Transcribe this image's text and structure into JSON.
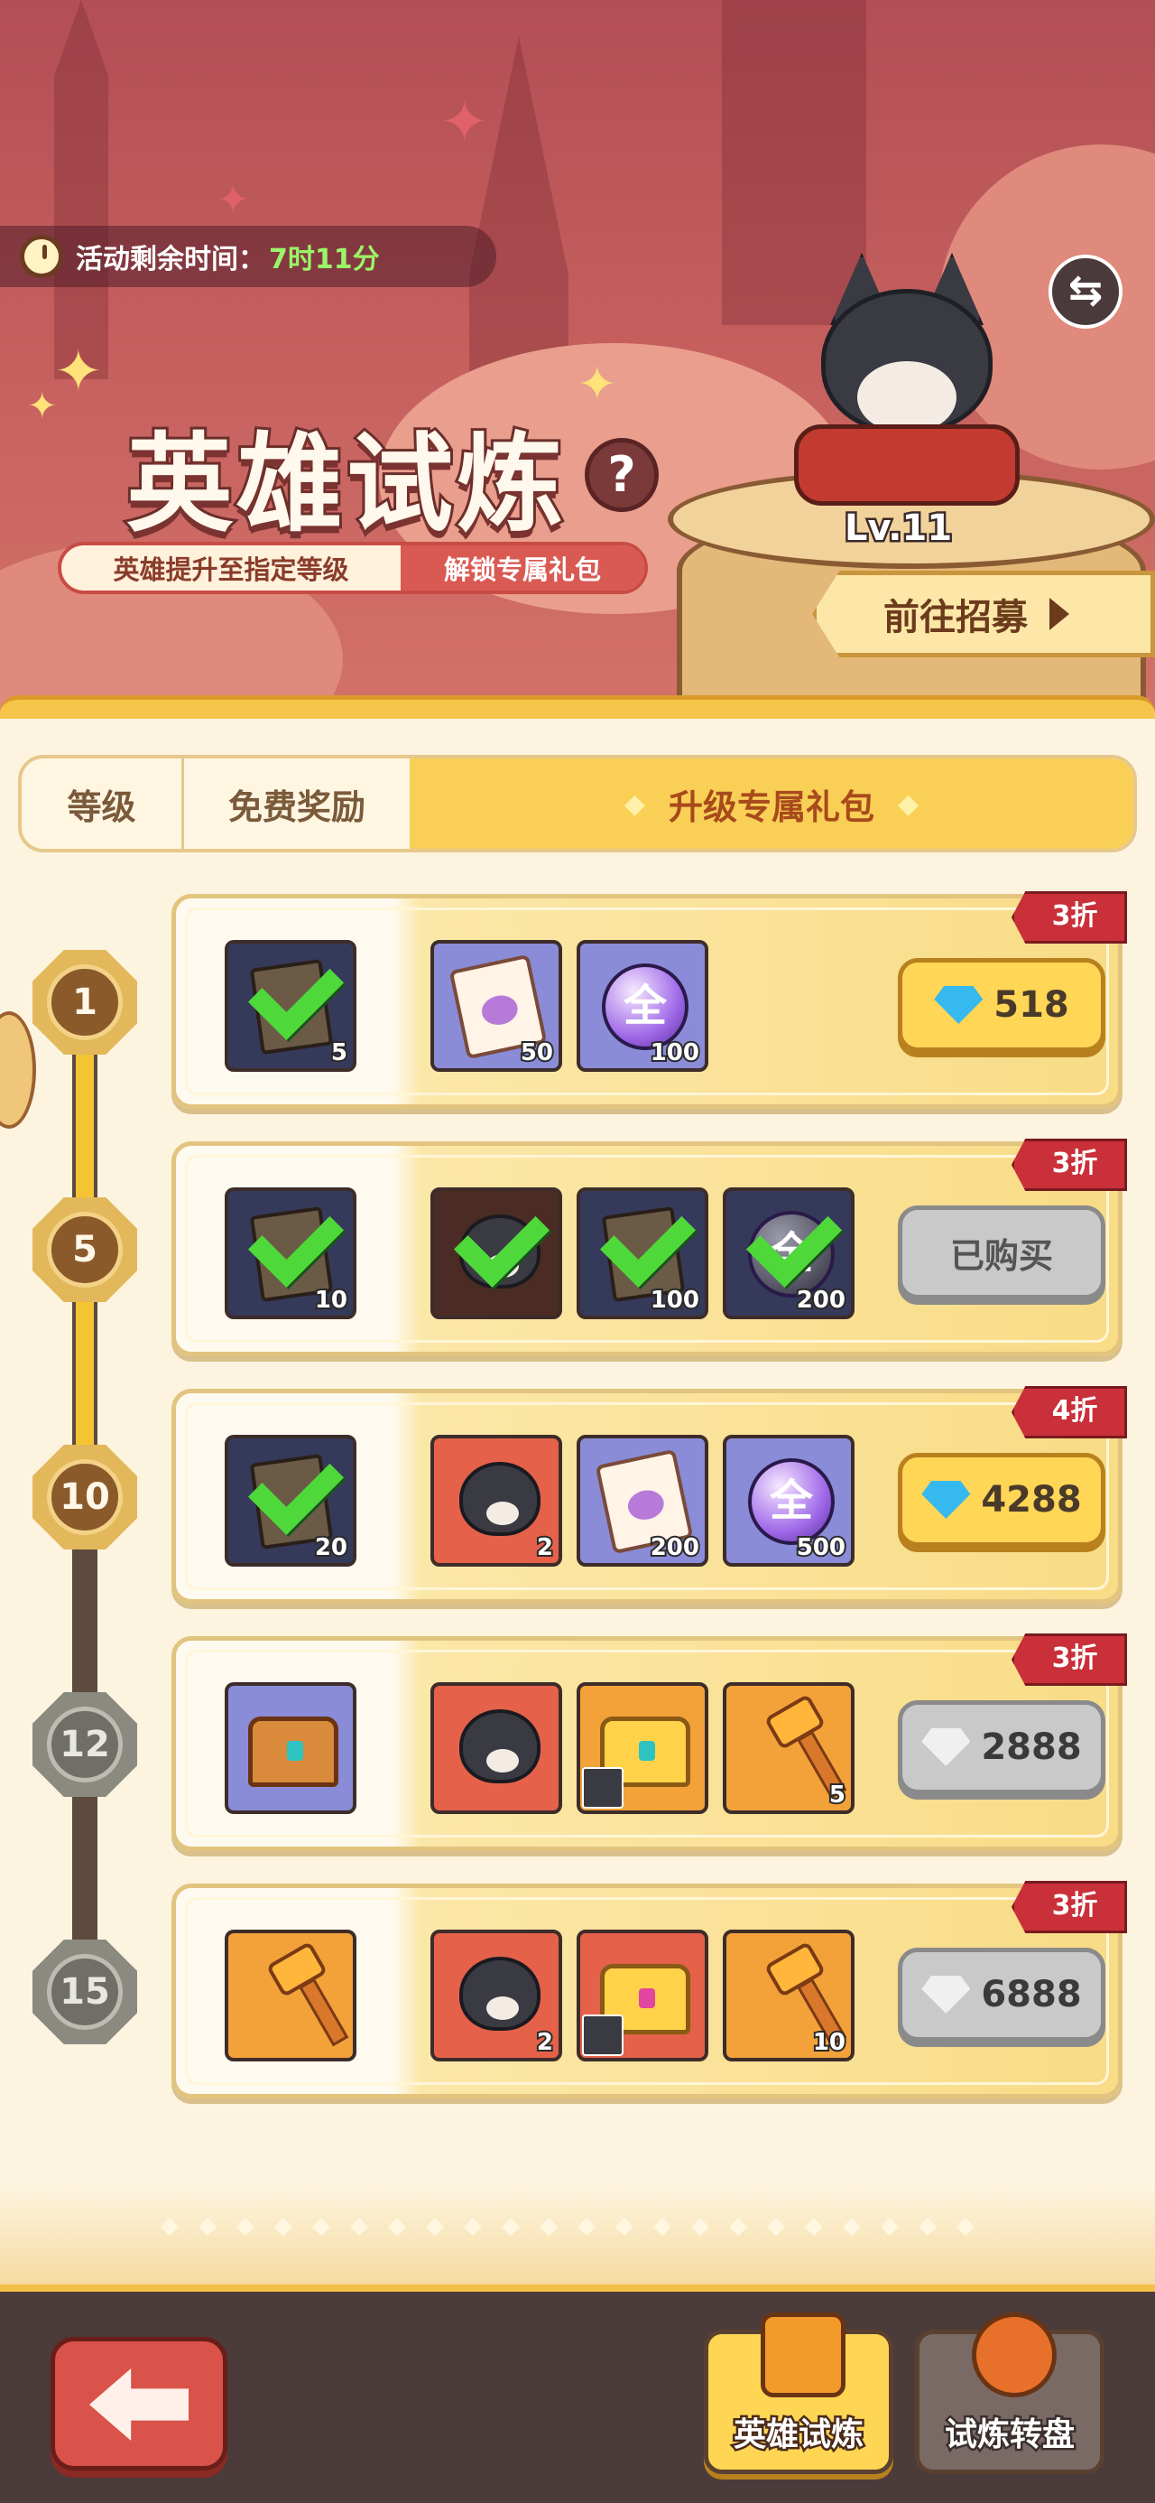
{
  "header": {
    "timer_label": "活动剩余时间：",
    "timer_value": "7时11分",
    "title": "英雄试炼",
    "help_label": "?",
    "subtitle_left": "英雄提升至指定等级",
    "subtitle_right": "解锁专属礼包",
    "hero_level": "Lv.11",
    "recruit_label": "前往招募"
  },
  "tabs": [
    {
      "label": "等级"
    },
    {
      "label": "免费奖励"
    },
    {
      "label": "升级专属礼包"
    }
  ],
  "levels": [
    "1",
    "5",
    "10",
    "12",
    "15"
  ],
  "rows": [
    {
      "discount": "3折",
      "free": {
        "icon": "integral-book-icon",
        "count": "5",
        "claimed": true
      },
      "items": [
        {
          "icon": "integral-scroll-icon",
          "count": "50"
        },
        {
          "icon": "all-orb-icon",
          "count": "100",
          "text": "全"
        }
      ],
      "price": "518",
      "purchased": false,
      "currency": "diamond"
    },
    {
      "discount": "3折",
      "free": {
        "icon": "integral-book-icon",
        "count": "10",
        "claimed": true
      },
      "items": [
        {
          "icon": "husky-hero-icon",
          "count": "",
          "claimed": true
        },
        {
          "icon": "integral-book-icon",
          "count": "100",
          "claimed": true
        },
        {
          "icon": "all-orb-icon",
          "count": "200",
          "claimed": true,
          "text": "全"
        }
      ],
      "price": "已购买",
      "purchased": true,
      "currency": ""
    },
    {
      "discount": "4折",
      "free": {
        "icon": "integral-book-icon",
        "count": "20",
        "claimed": true
      },
      "items": [
        {
          "icon": "husky-hero-icon",
          "count": "2"
        },
        {
          "icon": "integral-scroll-icon",
          "count": "200"
        },
        {
          "icon": "all-orb-icon",
          "count": "500",
          "text": "全"
        }
      ],
      "price": "4288",
      "purchased": false,
      "currency": "diamond"
    },
    {
      "discount": "3折",
      "free": {
        "icon": "treasure-chest-icon",
        "count": "",
        "claimed": false
      },
      "items": [
        {
          "icon": "husky-hero-icon",
          "count": ""
        },
        {
          "icon": "golden-chest-icon",
          "count": ""
        },
        {
          "icon": "golden-hammer-icon",
          "count": "5"
        }
      ],
      "price": "2888",
      "purchased": false,
      "currency": "locked-diamond"
    },
    {
      "discount": "3折",
      "free": {
        "icon": "golden-hammer-icon",
        "count": "",
        "claimed": false
      },
      "items": [
        {
          "icon": "husky-hero-icon",
          "count": "2"
        },
        {
          "icon": "legendary-chest-icon",
          "count": ""
        },
        {
          "icon": "golden-hammer-icon",
          "count": "10"
        }
      ],
      "price": "6888",
      "purchased": false,
      "currency": "locked-diamond"
    }
  ],
  "bottom": {
    "nav_hero_trial": "英雄试炼",
    "nav_trial_wheel": "试炼转盘"
  },
  "colors": {
    "accent": "#f9cf55",
    "discount": "#c9303a",
    "check": "#4fd83a"
  }
}
